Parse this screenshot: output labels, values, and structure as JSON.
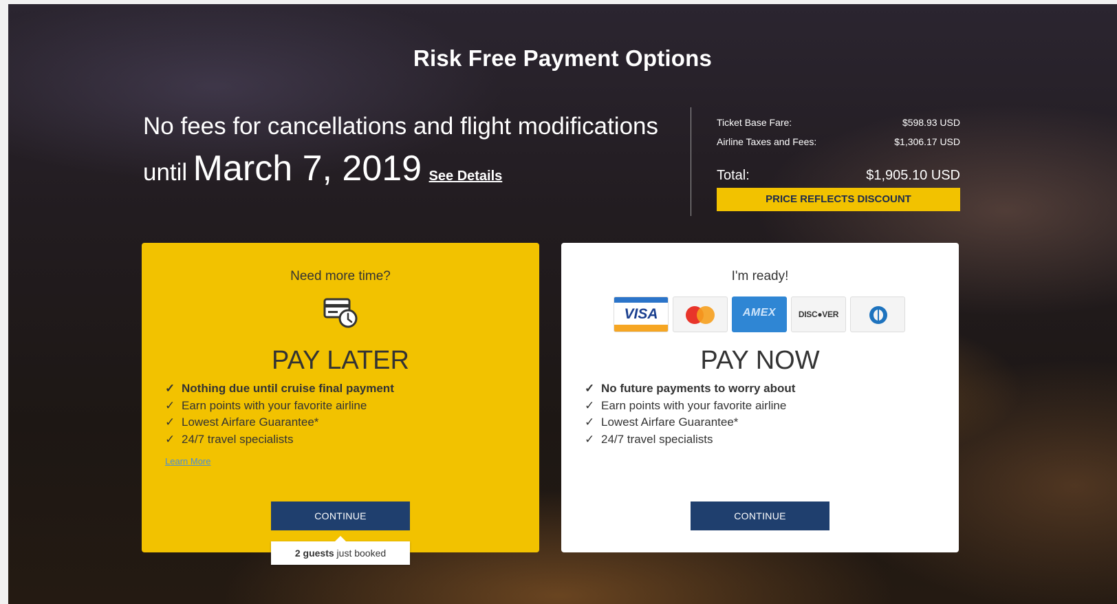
{
  "header": {
    "title": "Risk Free Payment Options"
  },
  "headline": {
    "line1": "No fees for cancellations and flight modifications",
    "until": "until",
    "date": "March 7, 2019",
    "see_details": "See Details"
  },
  "pricing": {
    "base_fare_label": "Ticket Base Fare:",
    "base_fare_value": "$598.93 USD",
    "taxes_label": "Airline Taxes and Fees:",
    "taxes_value": "$1,306.17 USD",
    "total_label": "Total:",
    "total_value": "$1,905.10 USD",
    "discount_banner": "PRICE REFLECTS DISCOUNT"
  },
  "pay_later": {
    "prompt": "Need more time?",
    "icon": "card-clock-icon",
    "title": "PAY LATER",
    "features": [
      "Nothing due until cruise final payment",
      "Earn points with your favorite airline",
      "Lowest Airfare Guarantee*",
      "24/7 travel specialists"
    ],
    "check": "✓",
    "learn_more": "Learn More",
    "continue_label": "CONTINUE",
    "booked_count": "2 guests",
    "booked_suffix": " just booked"
  },
  "pay_now": {
    "prompt": "I'm ready!",
    "logos": {
      "visa": "VISA",
      "amex": "AMEX",
      "discover": "DISC●VER"
    },
    "title": "PAY NOW",
    "features": [
      "No future payments to worry about",
      "Earn points with your favorite airline",
      "Lowest Airfare Guarantee*",
      "24/7 travel specialists"
    ],
    "check": "✓",
    "continue_label": "CONTINUE"
  },
  "colors": {
    "accent_yellow": "#f2c200",
    "button_navy": "#1f3f6e"
  }
}
